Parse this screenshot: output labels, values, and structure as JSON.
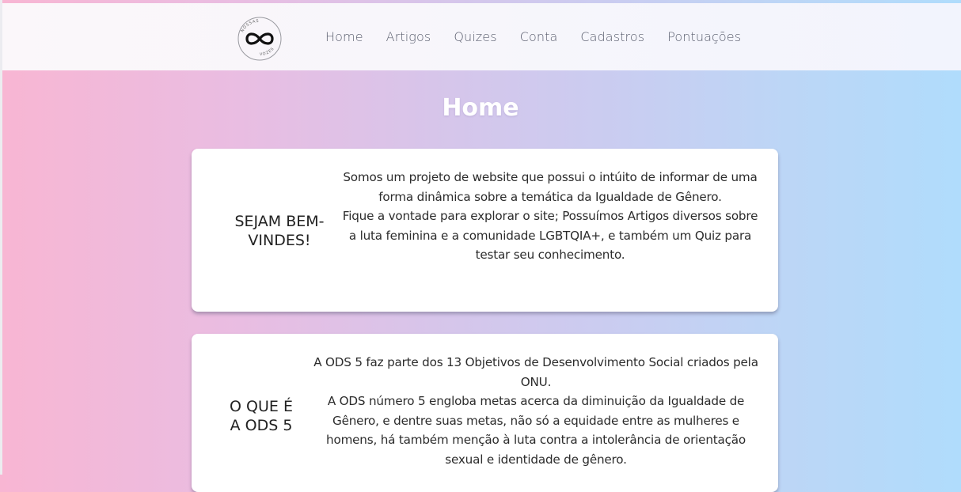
{
  "logo": {
    "icon": "infinity-icon",
    "top_text": "NOSSAS",
    "bottom_text": "VOZES"
  },
  "nav": {
    "items": [
      {
        "label": "Home"
      },
      {
        "label": "Artigos"
      },
      {
        "label": "Quizes"
      },
      {
        "label": "Conta"
      },
      {
        "label": "Cadastros"
      },
      {
        "label": "Pontuações"
      }
    ]
  },
  "page": {
    "title": "Home"
  },
  "cards": [
    {
      "title": "SEJAM BEM-VINDES!",
      "paragraphs": [
        "Somos um projeto de website que possui o intúito de informar de uma forma dinâmica sobre a temática da Igualdade de Gênero.",
        "Fique a vontade para explorar o site; Possuímos Artigos diversos sobre a luta feminina e a comunidade LGBTQIA+, e também um Quiz para testar seu conhecimento."
      ]
    },
    {
      "title": "O QUE É A ODS 5",
      "paragraphs": [
        "A ODS 5 faz parte dos 13 Objetivos de Desenvolvimento Social criados pela ONU.",
        "A ODS número 5 engloba metas acerca da diminuição da Igualdade de Gênero, e dentre suas metas, não só a equidade entre as mulheres e homens, há também menção à luta contra a intolerância de orientação sexual e identidade de gênero."
      ]
    }
  ],
  "colors": {
    "text_dark": "#222222",
    "nav_text": "#5c6070",
    "card_bg": "#ffffff"
  }
}
